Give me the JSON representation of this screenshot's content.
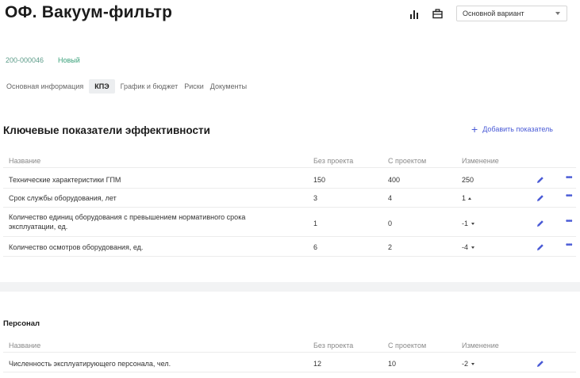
{
  "header": {
    "title": "ОФ. Вакуум-фильтр",
    "variant_value": "Основной вариант"
  },
  "meta": {
    "code": "200-000046",
    "status": "Новый"
  },
  "tabs": [
    {
      "label": "Основная информация"
    },
    {
      "label": "КПЭ"
    },
    {
      "label": "График и бюджет"
    },
    {
      "label": "Риски"
    },
    {
      "label": "Документы"
    }
  ],
  "kpi": {
    "title": "Ключевые показатели эффективности",
    "add_label": "Добавить показатель",
    "columns": {
      "name": "Название",
      "without": "Без проекта",
      "with": "С проектом",
      "change": "Изменение"
    },
    "rows": [
      {
        "name": "Технические характеристики ГПМ",
        "without": "150",
        "with": "400",
        "change": "250",
        "trend": "none"
      },
      {
        "name": "Срок службы оборудования, лет",
        "without": "3",
        "with": "4",
        "change": "1",
        "trend": "up"
      },
      {
        "name_l1": "Количество единиц оборудования с превышением нормативного срока",
        "name_l2": "эксплуатации, ед.",
        "without": "1",
        "with": "0",
        "change": "-1",
        "trend": "down"
      },
      {
        "name": "Количество осмотров оборудования, ед.",
        "without": "6",
        "with": "2",
        "change": "-4",
        "trend": "down"
      }
    ]
  },
  "staff": {
    "title": "Персонал",
    "columns": {
      "name": "Название",
      "without": "Без проекта",
      "with": "С проектом",
      "change": "Изменение"
    },
    "rows": [
      {
        "name": "Численность эксплуатирующего персонала, чел.",
        "without": "12",
        "with": "10",
        "change": "-2",
        "trend": "down"
      }
    ]
  },
  "icons": {
    "chart": "bar-chart-icon",
    "briefcase": "briefcase-icon",
    "edit": "pencil-icon",
    "more": "more-dots-icon",
    "add": "plus-icon"
  },
  "colors": {
    "accent": "#4a5bd6",
    "status_green": "#3aa17a",
    "code": "#5d9c8a"
  }
}
